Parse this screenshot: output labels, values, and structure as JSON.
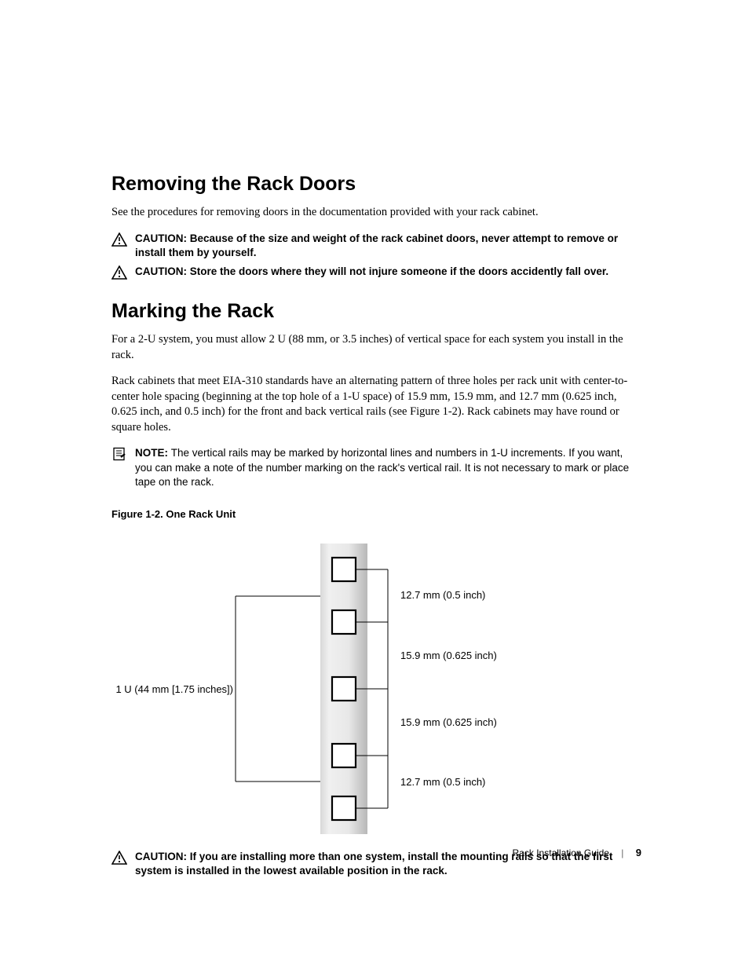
{
  "section1": {
    "heading": "Removing the Rack Doors",
    "p1": "See the procedures for removing doors in the documentation provided with your rack cabinet.",
    "caution1_lead": "CAUTION: ",
    "caution1": "Because of the size and weight of the rack cabinet doors, never attempt to remove or install them by yourself.",
    "caution2_lead": "CAUTION: ",
    "caution2": "Store the doors where they will not injure someone if the doors accidently fall over."
  },
  "section2": {
    "heading": "Marking the Rack",
    "p1": "For a 2-U system, you must allow 2 U (88 mm, or 3.5 inches) of vertical space for each system you install in the rack.",
    "p2": "Rack cabinets that meet EIA-310 standards have an alternating pattern of three holes per rack unit with center-to-center hole spacing (beginning at the top hole of a 1-U space) of 15.9 mm, 15.9 mm, and 12.7 mm (0.625 inch, 0.625 inch, and 0.5 inch) for the front and back vertical rails (see Figure 1-2). Rack cabinets may have round or square holes.",
    "note_lead": "NOTE: ",
    "note": "The vertical rails may be marked by horizontal lines and numbers in 1-U increments. If you want, you can make a note of the number marking on the rack's vertical rail. It is not necessary to mark or place tape on the rack.",
    "fig_caption": "Figure 1-2.    One Rack Unit",
    "label_left": "1 U (44 mm [1.75 inches])",
    "label_r1": "12.7 mm (0.5 inch)",
    "label_r2": "15.9 mm (0.625 inch)",
    "label_r3": "15.9 mm (0.625 inch)",
    "label_r4": "12.7 mm (0.5 inch)",
    "caution3_lead": "CAUTION: ",
    "caution3": "If you are installing more than one system, install the mounting rails so that the first system is installed in the lowest available position in the rack."
  },
  "footer": {
    "title": "Rack Installation Guide",
    "page": "9"
  }
}
